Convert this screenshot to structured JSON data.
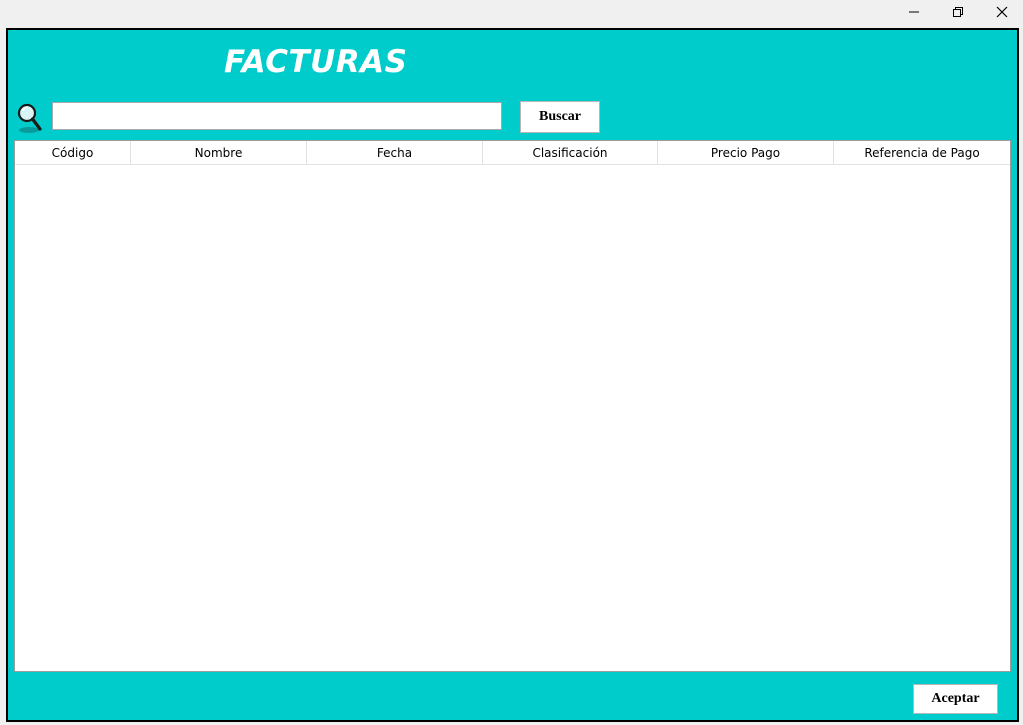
{
  "window": {
    "controls": {
      "minimize_icon": "minimize-icon",
      "restore_icon": "restore-icon",
      "close_icon": "close-icon"
    }
  },
  "header": {
    "title": "FACTURAS"
  },
  "search": {
    "value": "",
    "placeholder": "",
    "button_label": "Buscar"
  },
  "table": {
    "columns": [
      "Código",
      "Nombre",
      "Fecha",
      "Clasificación",
      "Precio Pago",
      "Referencia de Pago"
    ],
    "rows": []
  },
  "footer": {
    "accept_label": "Aceptar"
  },
  "colors": {
    "background": "#00cccc",
    "title": "#ffffff"
  }
}
